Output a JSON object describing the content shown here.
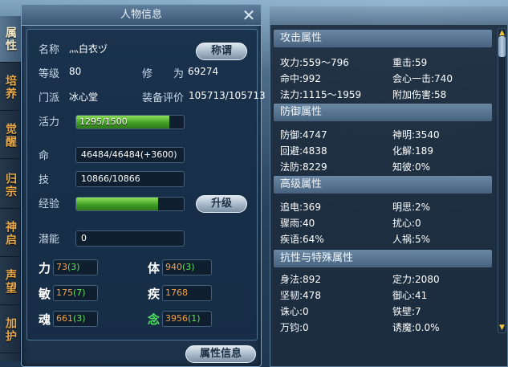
{
  "side_tabs": [
    "属性",
    "培养",
    "觉醒",
    "归宗",
    "神启",
    "声望",
    "加护"
  ],
  "background_title": "",
  "panel": {
    "title": "人物信息",
    "close_glyph": "✕",
    "name_label": "名称",
    "name_value": "灬白衣ヅ",
    "title_button": "称谓",
    "level_label": "等级",
    "level_value": "80",
    "cultivation_label": "修　　为",
    "cultivation_value": "69274",
    "sect_label": "门派",
    "sect_value": "冰心堂",
    "equip_label": "装备评价",
    "equip_value": "105713/105713",
    "vitality_label": "活力",
    "vitality_text": "1295/1500",
    "vitality_fraction": 0.863,
    "hp_label": "命",
    "hp_value": "46484/46484(+3600)",
    "skill_label": "技",
    "skill_value": "10866/10866",
    "exp_label": "经验",
    "exp_fraction": 0.76,
    "upgrade_button": "升级",
    "potential_label": "潜能",
    "potential_value": "0",
    "attrs": {
      "str": {
        "label": "力",
        "base": "73",
        "bonus": "(3)"
      },
      "con": {
        "label": "体",
        "base": "940",
        "bonus": "(3)"
      },
      "agi": {
        "label": "敏",
        "base": "175",
        "bonus": "(7)"
      },
      "spd": {
        "label": "疾",
        "base": "1768",
        "bonus": ""
      },
      "soul": {
        "label": "魂",
        "base": "661",
        "bonus": "(3)"
      },
      "mind": {
        "label": "念",
        "base": "3956",
        "bonus": "(1)"
      }
    },
    "attr_info_button": "属性信息"
  },
  "stats": {
    "attack": {
      "title": "攻击属性",
      "items": [
        "攻力:559～796",
        "重击:59",
        "命中:992",
        "会心一击:740",
        "法力:1115～1959",
        "附加伤害:58"
      ]
    },
    "defense": {
      "title": "防御属性",
      "items": [
        "防御:4747",
        "神明:3540",
        "回避:4838",
        "化解:189",
        "法防:8229",
        "知彼:0%"
      ]
    },
    "advanced": {
      "title": "高级属性",
      "items": [
        "追电:369",
        "明思:2%",
        "骤雨:40",
        "扰心:0",
        "疾语:64%",
        "人祸:5%"
      ]
    },
    "resist": {
      "title": "抗性与特殊属性",
      "items": [
        "身法:892",
        "定力:2080",
        "坚韧:478",
        "御心:41",
        "诛心:0",
        "铁壁:7",
        "万钧:0",
        "诱魔:0.0%"
      ]
    }
  },
  "colors": {
    "attr_base": "#f2a04a",
    "attr_bonus": "#62e05a",
    "tab_text": "#e8a94a",
    "bar_fill": "#4caf2a"
  }
}
